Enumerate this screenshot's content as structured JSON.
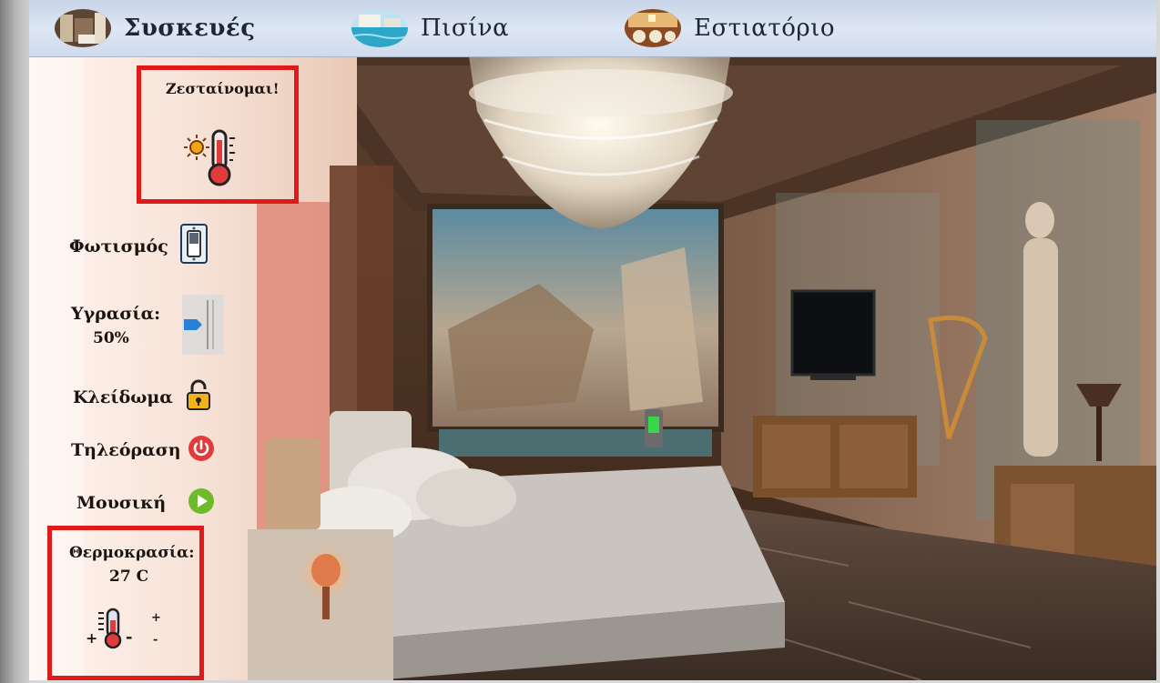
{
  "nav": {
    "items": [
      {
        "label": "Συσκευές",
        "active": true,
        "thumb": "room-thumbnail"
      },
      {
        "label": "Πισίνα",
        "active": false,
        "thumb": "pool-thumbnail"
      },
      {
        "label": "Εστιατόριο",
        "active": false,
        "thumb": "restaurant-thumbnail"
      }
    ]
  },
  "status": {
    "message": "Ζεσταίνομαι!",
    "icon": "hot-thermometer-icon"
  },
  "controls": {
    "lighting": {
      "label": "Φωτισμός",
      "icon": "light-switch-icon"
    },
    "humidity": {
      "label": "Υγρασία:",
      "value": "50%",
      "level": 0.5,
      "icon": "humidity-slider"
    },
    "lock": {
      "label": "Κλείδωμα",
      "icon": "padlock-icon"
    },
    "tv": {
      "label": "Τηλεόραση",
      "icon": "power-icon"
    },
    "music": {
      "label": "Μουσική",
      "icon": "play-icon"
    },
    "temperature": {
      "label": "Θερμοκρασία:",
      "value": "27 C",
      "increase": "+",
      "decrease": "-",
      "icon": "thermometer-icon"
    }
  },
  "colors": {
    "highlight": "#e01919",
    "power": "#e23b3b",
    "play": "#6dbb2a",
    "lock": "#f2b319",
    "nav_bg": "#d3ddee"
  }
}
